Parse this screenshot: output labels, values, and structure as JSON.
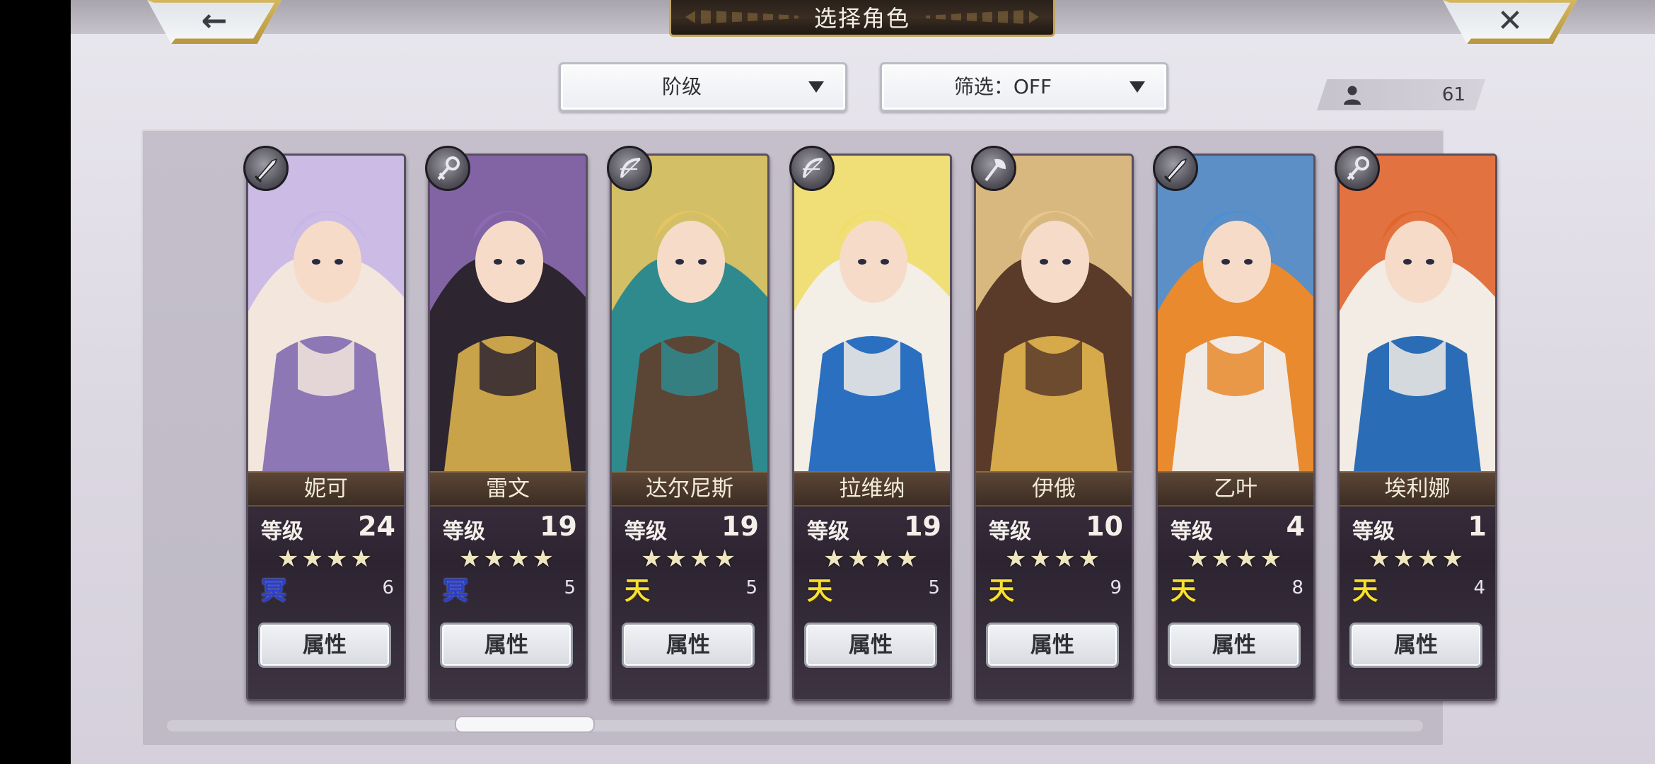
{
  "header": {
    "title": "选择角色",
    "back_icon": "←",
    "close_icon": "✕"
  },
  "filters": {
    "rank_label": "阶级",
    "filter_label": "筛选：OFF"
  },
  "roster_count": "61",
  "level_label": "等级",
  "attribute_label": "属性",
  "stars": "★★★★",
  "rank_glyphs": {
    "ming": "冥",
    "tian": "天"
  },
  "characters": [
    {
      "name": "妮可",
      "level": "24",
      "rank": "ming",
      "rank_glyph": "冥",
      "rank_count": "6",
      "weapon": "sword-icon",
      "stars": 4,
      "palette": [
        "#c7b6e6",
        "#f3e6dc",
        "#8d77b5"
      ]
    },
    {
      "name": "雷文",
      "level": "19",
      "rank": "ming",
      "rank_glyph": "冥",
      "rank_count": "5",
      "weapon": "key-icon",
      "stars": 4,
      "palette": [
        "#8c6bb3",
        "#2d2530",
        "#c9a34a"
      ]
    },
    {
      "name": "达尔尼斯",
      "level": "19",
      "rank": "tian",
      "rank_glyph": "天",
      "rank_count": "5",
      "weapon": "bow-icon",
      "stars": 4,
      "palette": [
        "#e6c461",
        "#2f8a8e",
        "#5b4636"
      ]
    },
    {
      "name": "拉维纳",
      "level": "19",
      "rank": "tian",
      "rank_glyph": "天",
      "rank_count": "5",
      "weapon": "bow-icon",
      "stars": 4,
      "palette": [
        "#f0dd6a",
        "#f3eee6",
        "#2a6fc0"
      ]
    },
    {
      "name": "伊俄",
      "level": "10",
      "rank": "tian",
      "rank_glyph": "天",
      "rank_count": "9",
      "weapon": "axe-icon",
      "stars": 4,
      "palette": [
        "#e7c78a",
        "#5a3b2a",
        "#d6a94a"
      ]
    },
    {
      "name": "乙叶",
      "level": "4",
      "rank": "tian",
      "rank_glyph": "天",
      "rank_count": "8",
      "weapon": "sword-icon",
      "stars": 4,
      "palette": [
        "#4d8fd6",
        "#e88a2d",
        "#f1e9e4"
      ]
    },
    {
      "name": "埃利娜",
      "level": "1",
      "rank": "tian",
      "rank_glyph": "天",
      "rank_count": "4",
      "weapon": "key-icon",
      "stars": 4,
      "palette": [
        "#e0662e",
        "#f2ece4",
        "#2b6cb6"
      ]
    }
  ]
}
